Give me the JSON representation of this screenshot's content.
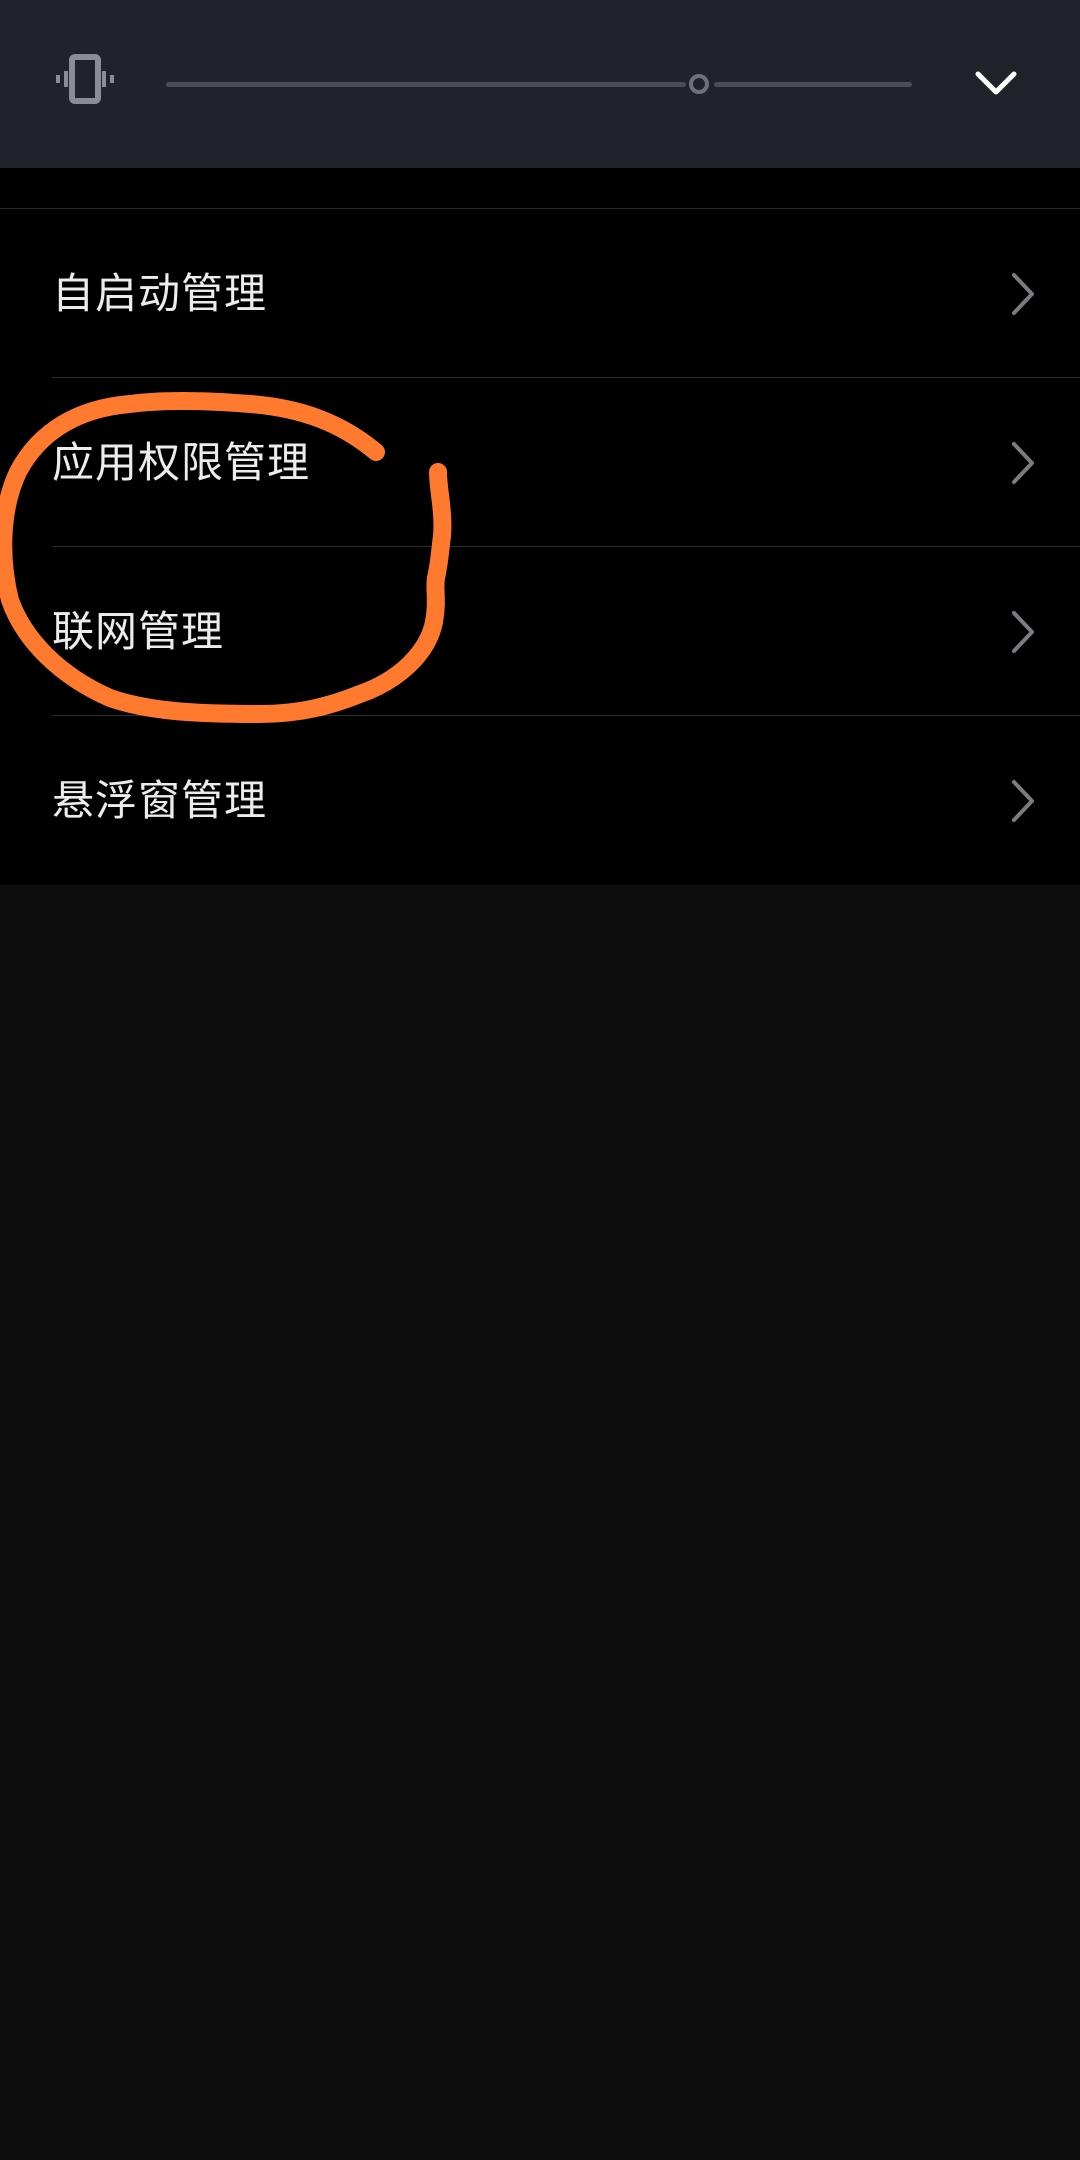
{
  "volume_panel": {
    "mode_icon": "vibrate-icon",
    "slider_level": 0.7,
    "collapse_icon": "chevron-down-icon"
  },
  "settings": {
    "items": [
      {
        "label": "自启动管理",
        "icon": "chevron-right-icon"
      },
      {
        "label": "应用权限管理",
        "icon": "chevron-right-icon"
      },
      {
        "label": "联网管理",
        "icon": "chevron-right-icon"
      },
      {
        "label": "悬浮窗管理",
        "icon": "chevron-right-icon"
      }
    ]
  },
  "annotation": {
    "shape": "hand-drawn-circle",
    "color": "#ff7a2f"
  },
  "colors": {
    "panel_bg": "#20232a",
    "list_bg": "#000000",
    "page_bg": "#0d0d0e",
    "text": "#ececec",
    "chevron": "#7a7c80"
  }
}
